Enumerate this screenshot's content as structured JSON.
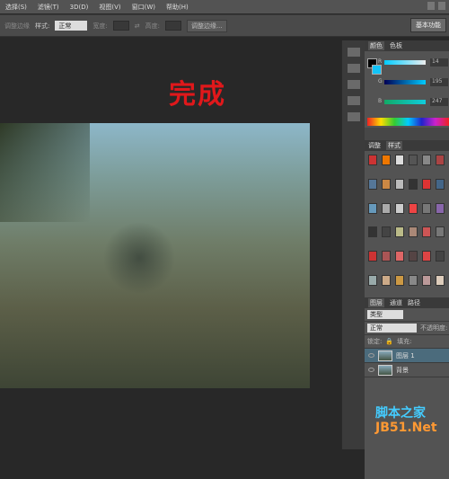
{
  "menu": [
    "选择(S)",
    "滤镜(T)",
    "3D(D)",
    "视图(V)",
    "窗口(W)",
    "帮助(H)"
  ],
  "options": {
    "refine_edge": "调整边缘",
    "style_label": "样式:",
    "style_value": "正常",
    "width_label": "宽度:",
    "height_label": "高度:",
    "refine_button": "调整边缘...",
    "workspace": "基本功能"
  },
  "canvas": {
    "title": "完成",
    "accent": "#e0181b"
  },
  "color_panel": {
    "tabs": [
      "颜色",
      "色板"
    ],
    "r_label": "R",
    "g_label": "G",
    "b_label": "B",
    "r": "14",
    "g": "195",
    "b": "247",
    "foreground": "#000000",
    "background": "#0ec3f7"
  },
  "styles_panel": {
    "tabs": [
      "调整",
      "样式"
    ]
  },
  "layers_panel": {
    "tabs": [
      "图层",
      "通道",
      "路径"
    ],
    "filter": "类型",
    "blend": "正常",
    "opacity_label": "不透明度:",
    "lock_label": "锁定:",
    "fill_label": "填充:",
    "layers": [
      {
        "name": "图层 1",
        "active": true
      },
      {
        "name": "背景",
        "active": false
      }
    ]
  },
  "watermark": {
    "line1": "脚本之家",
    "line2": "JB51.Net"
  }
}
